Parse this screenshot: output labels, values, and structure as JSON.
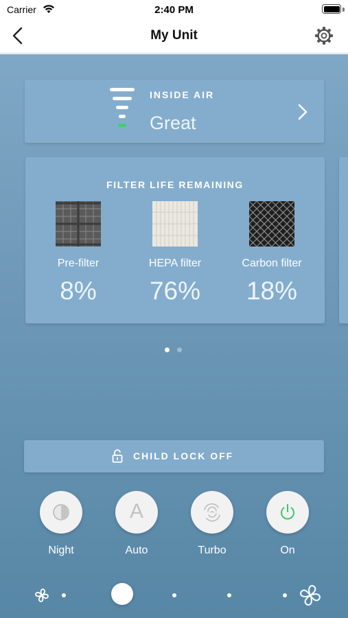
{
  "status_bar": {
    "carrier": "Carrier",
    "time": "2:40 PM"
  },
  "nav": {
    "title": "My Unit",
    "back_icon": "chevron-left",
    "settings_icon": "gear"
  },
  "air_quality": {
    "label": "INSIDE AIR",
    "value": "Great",
    "level_icon": "air-quality-bars",
    "accent_color": "#3fcf6f"
  },
  "filters": {
    "title": "FILTER LIFE REMAINING",
    "items": [
      {
        "name": "Pre-filter",
        "percent": "8%"
      },
      {
        "name": "HEPA filter",
        "percent": "76%"
      },
      {
        "name": "Carbon filter",
        "percent": "18%"
      }
    ]
  },
  "pager": {
    "pages": 2,
    "active": 1
  },
  "child_lock": {
    "label": "CHILD LOCK OFF",
    "icon": "unlocked-padlock"
  },
  "modes": [
    {
      "label": "Night",
      "icon": "night-mode"
    },
    {
      "label": "Auto",
      "icon": "letter-a",
      "glyph": "A"
    },
    {
      "label": "Turbo",
      "icon": "turbo-swirl"
    },
    {
      "label": "On",
      "icon": "power",
      "color": "#3fc46a"
    }
  ],
  "fan_speed": {
    "levels": 5,
    "selected_level": 2,
    "min_icon": "fan-small",
    "max_icon": "fan-large"
  }
}
